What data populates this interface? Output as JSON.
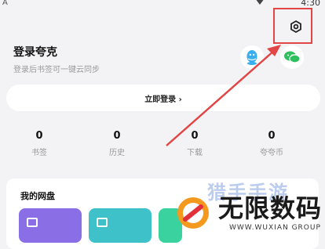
{
  "status_bar": {
    "left_glyph": "A",
    "time": "4:30"
  },
  "settings": {
    "icon": "settings-gear-icon"
  },
  "login": {
    "title": "登录夸克",
    "subtitle": "登录后书签可一键云同步",
    "button_label": "立即登录 ›"
  },
  "social": {
    "qq_icon": "qq-icon",
    "wechat_icon": "wechat-icon"
  },
  "stats": [
    {
      "value": "0",
      "label": "书签"
    },
    {
      "value": "0",
      "label": "历史"
    },
    {
      "value": "0",
      "label": "下载"
    },
    {
      "value": "0",
      "label": "夸夸币"
    }
  ],
  "cloud": {
    "title": "我的网盘"
  },
  "watermark": {
    "top_text": "猎手手游",
    "main_text": "无限数码",
    "sub_text": "WWW.WUXIAN GROUP"
  },
  "colors": {
    "accent_red": "#e24545",
    "qq_blue": "#37aef0",
    "wechat_green": "#2fbf5f"
  }
}
